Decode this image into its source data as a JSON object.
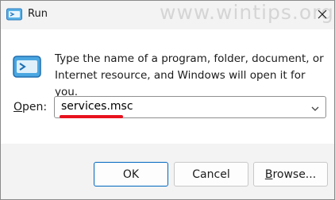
{
  "window": {
    "title": "Run",
    "watermark": "www.wintips.org"
  },
  "dialog": {
    "description_line1": "Type the name of a program, folder, document, or",
    "description_line2": "Internet resource, and Windows will open it for you.",
    "open_label_accel": "O",
    "open_label_rest": "pen:",
    "input_value": "services.msc"
  },
  "buttons": {
    "ok": "OK",
    "cancel": "Cancel",
    "browse_accel": "B",
    "browse_rest": "rowse..."
  },
  "icons": {
    "app": "run-icon",
    "close": "close-icon",
    "dropdown": "chevron-down-icon"
  },
  "colors": {
    "accent": "#0067c0",
    "highlight_underline": "#e8121e"
  }
}
